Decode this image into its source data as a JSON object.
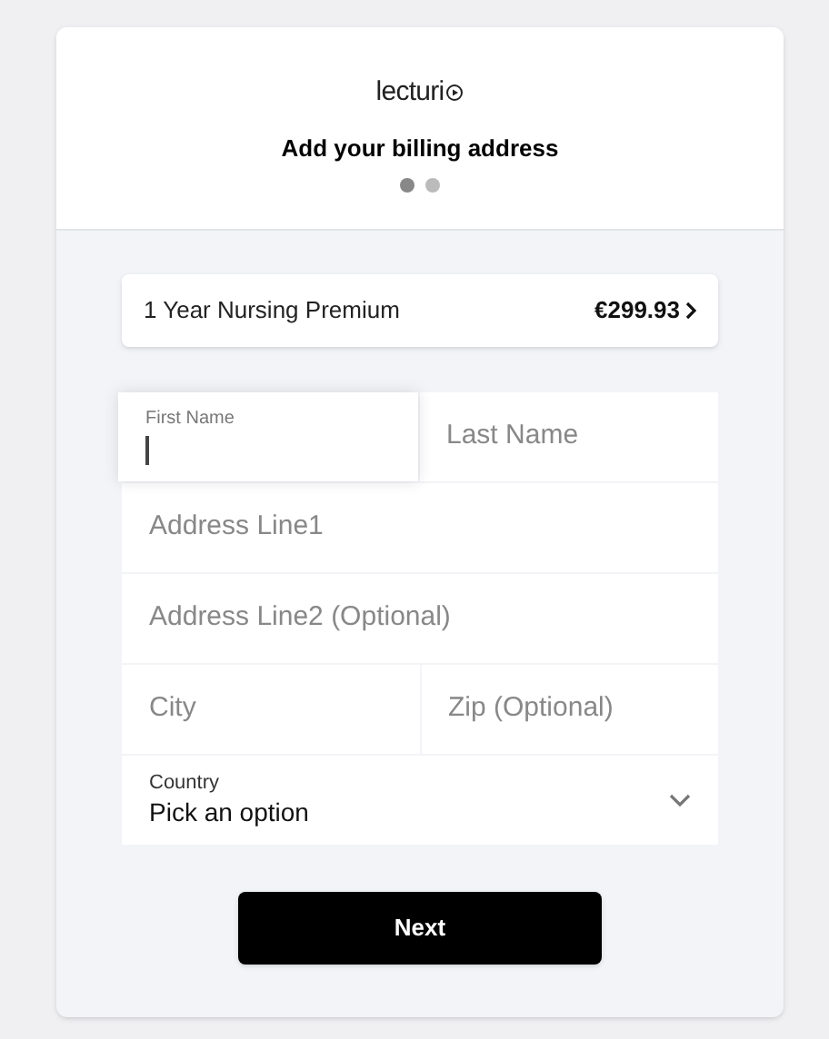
{
  "logo": {
    "text": "lecturi"
  },
  "title": "Add your billing address",
  "steps": [
    {
      "selected": true
    },
    {
      "selected": false
    }
  ],
  "product": {
    "name": "1 Year Nursing Premium",
    "price": "€299.93"
  },
  "field_rows": [
    [
      {
        "kind": "text",
        "label": "First Name",
        "focused": true
      },
      {
        "kind": "text",
        "placeholder": "Last Name",
        "focused": false
      }
    ],
    [
      {
        "kind": "text",
        "placeholder": "Address Line1",
        "focused": false
      }
    ],
    [
      {
        "kind": "text",
        "placeholder": "Address Line2 (Optional)",
        "focused": false
      }
    ],
    [
      {
        "kind": "text",
        "placeholder": "City",
        "focused": false
      },
      {
        "kind": "text",
        "placeholder": "Zip (Optional)",
        "focused": false
      }
    ],
    [
      {
        "kind": "select",
        "label": "Country",
        "value": "Pick an option"
      }
    ]
  ],
  "button": "Next"
}
